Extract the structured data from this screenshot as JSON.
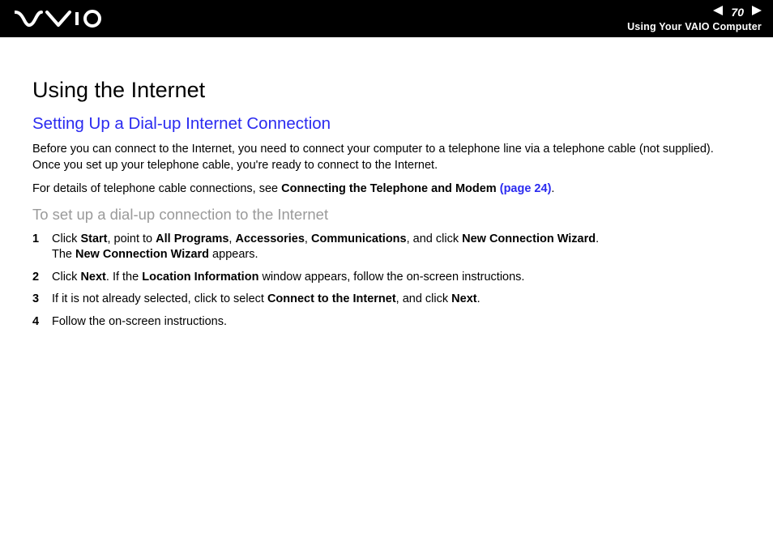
{
  "header": {
    "page_number": "70",
    "section": "Using Your VAIO Computer"
  },
  "content": {
    "title": "Using the Internet",
    "subtitle": "Setting Up a Dial-up Internet Connection",
    "intro1": "Before you can connect to the Internet, you need to connect your computer to a telephone line via a telephone cable (not supplied). Once you set up your telephone cable, you're ready to connect to the Internet.",
    "intro2_pre": "For details of telephone cable connections, see ",
    "intro2_bold": "Connecting the Telephone and Modem ",
    "intro2_link": "(page 24)",
    "intro2_post": ".",
    "procedure_title": "To set up a dial-up connection to the Internet",
    "steps": [
      {
        "n": "1",
        "segments": [
          {
            "t": "Click "
          },
          {
            "t": "Start",
            "b": true
          },
          {
            "t": ", point to "
          },
          {
            "t": "All Programs",
            "b": true
          },
          {
            "t": ", "
          },
          {
            "t": "Accessories",
            "b": true
          },
          {
            "t": ", "
          },
          {
            "t": "Communications",
            "b": true
          },
          {
            "t": ", and click "
          },
          {
            "t": "New Connection Wizard",
            "b": true
          },
          {
            "t": "."
          },
          {
            "br": true
          },
          {
            "t": "The "
          },
          {
            "t": "New Connection Wizard",
            "b": true
          },
          {
            "t": " appears."
          }
        ]
      },
      {
        "n": "2",
        "segments": [
          {
            "t": "Click "
          },
          {
            "t": "Next",
            "b": true
          },
          {
            "t": ". If the "
          },
          {
            "t": "Location Information",
            "b": true
          },
          {
            "t": " window appears, follow the on-screen instructions."
          }
        ]
      },
      {
        "n": "3",
        "segments": [
          {
            "t": "If it is not already selected, click to select "
          },
          {
            "t": "Connect to the Internet",
            "b": true
          },
          {
            "t": ", and click "
          },
          {
            "t": "Next",
            "b": true
          },
          {
            "t": "."
          }
        ]
      },
      {
        "n": "4",
        "segments": [
          {
            "t": "Follow the on-screen instructions."
          }
        ]
      }
    ]
  }
}
